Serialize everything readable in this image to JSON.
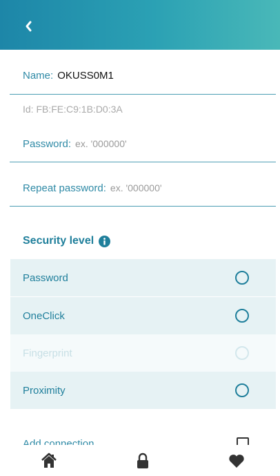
{
  "header": {
    "back_icon": "chevron-left-icon",
    "gradient": [
      "#1d86a8",
      "#49b8b8"
    ]
  },
  "form": {
    "name_label": "Name:",
    "name_value": "OKUSS0M1",
    "id_text": "Id: FB:FE:C9:1B:D0:3A",
    "password_label": "Password:",
    "password_placeholder": "ex. '000000'",
    "repeat_label": "Repeat password:",
    "repeat_placeholder": "ex. '000000'"
  },
  "security": {
    "title": "Security level",
    "info_icon": "info-icon",
    "options": [
      {
        "label": "Password",
        "selected": false,
        "enabled": true
      },
      {
        "label": "OneClick",
        "selected": false,
        "enabled": true
      },
      {
        "label": "Fingerprint",
        "selected": false,
        "enabled": false
      },
      {
        "label": "Proximity",
        "selected": false,
        "enabled": true
      }
    ]
  },
  "add_connection": {
    "label": "Add connection",
    "checked": false
  },
  "nav": {
    "items": [
      "home-icon",
      "lock-icon",
      "heart-icon"
    ]
  },
  "colors": {
    "accent": "#1f7f9b",
    "label": "#2f8aa6",
    "disabled": "#c7dfe5"
  }
}
